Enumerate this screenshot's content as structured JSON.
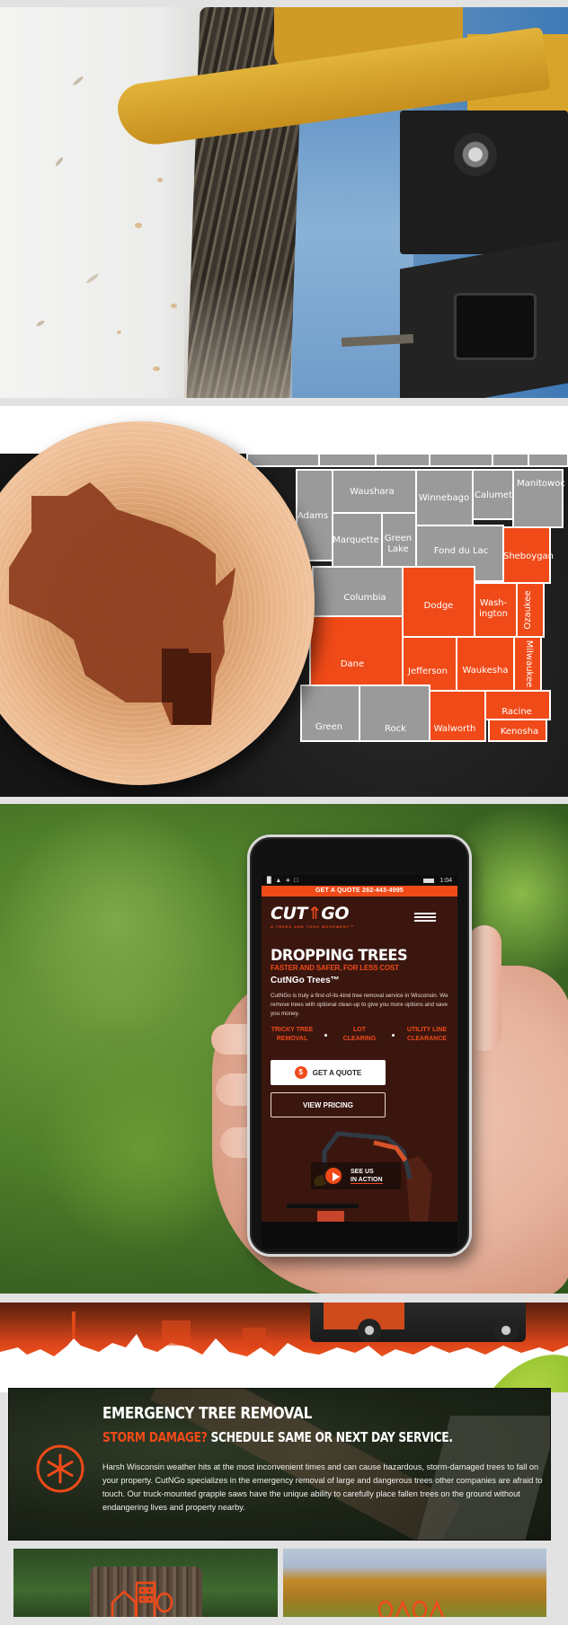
{
  "map": {
    "counties_gray": [
      "Waushara",
      "Winnebago",
      "Calumet",
      "Manitowoc",
      "Adams",
      "Marquette",
      "Green Lake",
      "Fond du Lac",
      "Columbia",
      "Green",
      "Rock"
    ],
    "counties_highlighted": [
      "Sheboygan",
      "Dodge",
      "Washington",
      "Ozaukee",
      "Dane",
      "Jefferson",
      "Waukesha",
      "Milwaukee",
      "Walworth",
      "Racine",
      "Kenosha"
    ],
    "labels": {
      "waushara": "Waushara",
      "winnebago": "Winnebago",
      "calumet": "Calumet",
      "manitowoc": "Manitowoc",
      "adams": "Adams",
      "marquette": "Marquette",
      "green_lake_1": "Green",
      "green_lake_2": "Lake",
      "fond_du_lac": "Fond du Lac",
      "sheboygan": "Sheboygan",
      "columbia": "Columbia",
      "dodge": "Dodge",
      "washington_1": "Wash-",
      "washington_2": "ington",
      "ozaukee": "Ozaukee",
      "dane": "Dane",
      "jefferson": "Jefferson",
      "waukesha": "Waukesha",
      "milwaukee": "Milwaukee",
      "green": "Green",
      "rock": "Rock",
      "walworth": "Walworth",
      "racine": "Racine",
      "kenosha": "Kenosha"
    },
    "colors": {
      "highlight": "#f04a18",
      "county": "#9a9a9a",
      "border": "#ffffff"
    }
  },
  "phone": {
    "status": {
      "time": "1:04"
    },
    "quote_bar": "GET A QUOTE 262-443-4995",
    "logo": {
      "cut": "CUT",
      "go": "GO",
      "tagline": "A TREES AND TONS MOVEMENT™"
    },
    "hero_title": "DROPPING TREES",
    "hero_subtitle": "FASTER AND SAFER, FOR LESS COST",
    "brand_heading": "CutNGo Trees™",
    "blurb": "CutNGo is truly a first-of-its-kind tree removal service in Wisconsin. We remove trees with optional clean-up to give you more options and save you money.",
    "services": [
      {
        "line1": "TRICKY TREE",
        "line2": "REMOVAL"
      },
      {
        "line1": "LOT",
        "line2": "CLEARING"
      },
      {
        "line1": "UTILITY LINE",
        "line2": "CLEARANCE"
      }
    ],
    "quote_button": "GET A QUOTE",
    "dollar_symbol": "$",
    "pricing_button": "VIEW PRICING",
    "video": {
      "line1": "SEE US",
      "line2": "IN ACTION"
    }
  },
  "emergency": {
    "title": "EMERGENCY TREE REMOVAL",
    "subtitle_highlight": "STORM DAMAGE?",
    "subtitle_rest": " SCHEDULE SAME OR NEXT DAY SERVICE.",
    "body": "Harsh Wisconsin weather hits at the most inconvenient times and can cause hazardous, storm-damaged trees to fall on your property. CutNGo specializes in the emergency removal of large and dangerous trees other companies are afraid to touch. Our truck-mounted grapple saws have the unique ability to carefully place fallen trees on the ground without endangering lives and property nearby."
  },
  "colors": {
    "accent": "#f04a18",
    "dark_brown": "#3a160f",
    "separator": "#e2e2e2"
  }
}
